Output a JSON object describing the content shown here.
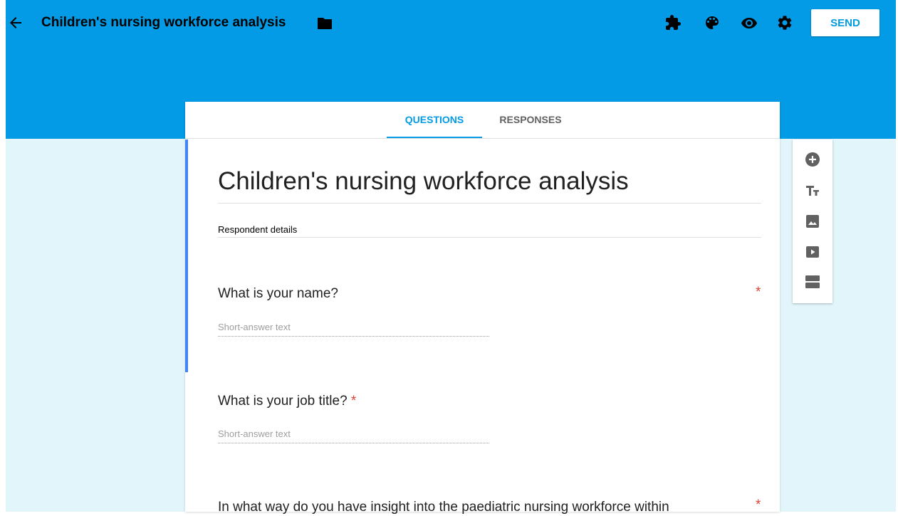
{
  "header": {
    "title": "Children's nursing workforce analysis",
    "send_label": "SEND",
    "icons": [
      "back-arrow-icon",
      "folder-icon",
      "addons-puzzle-icon",
      "palette-icon",
      "preview-eye-icon",
      "settings-gear-icon"
    ]
  },
  "tabs": [
    {
      "label": "QUESTIONS",
      "active": true
    },
    {
      "label": "RESPONSES",
      "active": false
    }
  ],
  "form": {
    "title": "Children's nursing workforce analysis",
    "description": "Respondent details"
  },
  "questions": [
    {
      "text": "What is your name?",
      "required_mark": "*",
      "placeholder": "Short-answer text"
    },
    {
      "text": "What is your job title?",
      "required_mark": "*",
      "placeholder": "Short-answer text"
    },
    {
      "text": "In what way do you have insight into the paediatric nursing workforce within",
      "required_mark": "*"
    }
  ],
  "side_toolbar": {
    "icons": [
      "add-question-icon",
      "title-text-icon",
      "image-icon",
      "video-icon",
      "section-icon"
    ]
  },
  "colors": {
    "header_bg": "#039be5",
    "page_bg": "#e1f5fb",
    "accent": "#039be5",
    "focus_bar": "#4285f4",
    "required": "#db4437"
  }
}
